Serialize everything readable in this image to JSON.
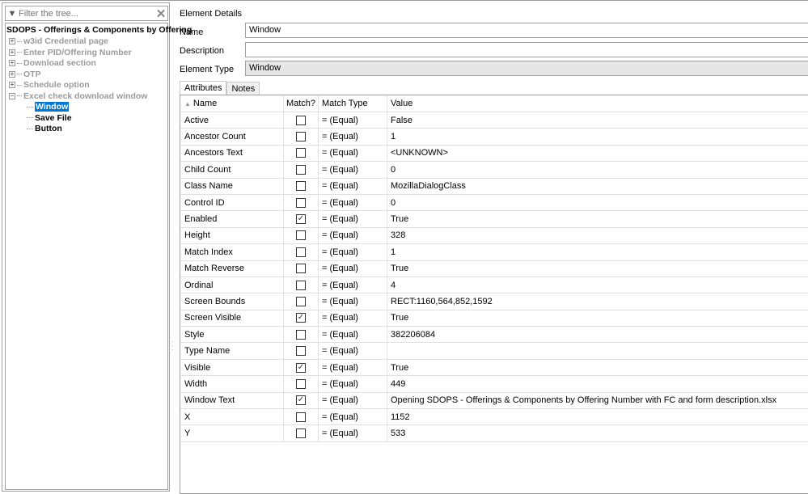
{
  "filter": {
    "placeholder": "Filter the tree..."
  },
  "tree": {
    "root": "SDOPS - Offerings & Components by Offering",
    "nodes": [
      "w3id Credential page",
      "Enter PID/Offering Number",
      "Download section",
      "OTP",
      "Schedule option",
      "Excel check download window"
    ],
    "children": [
      "Window",
      "Save File",
      "Button"
    ],
    "selected_child": "Window"
  },
  "details": {
    "title": "Element Details",
    "name_label": "Name",
    "name_value": "Window",
    "description_label": "Description",
    "description_value": "",
    "type_label": "Element Type",
    "type_value": "Window"
  },
  "tabs": [
    "Attributes",
    "Notes"
  ],
  "grid": {
    "headers": [
      "Name",
      "Match?",
      "Match Type",
      "Value"
    ],
    "rows": [
      {
        "name": "Active",
        "match": false,
        "type": "=  (Equal)",
        "value": "False"
      },
      {
        "name": "Ancestor Count",
        "match": false,
        "type": "=  (Equal)",
        "value": "1"
      },
      {
        "name": "Ancestors Text",
        "match": false,
        "type": "=  (Equal)",
        "value": "<UNKNOWN>"
      },
      {
        "name": "Child Count",
        "match": false,
        "type": "=  (Equal)",
        "value": "0"
      },
      {
        "name": "Class Name",
        "match": false,
        "type": "=  (Equal)",
        "value": "MozillaDialogClass"
      },
      {
        "name": "Control ID",
        "match": false,
        "type": "=  (Equal)",
        "value": "0"
      },
      {
        "name": "Enabled",
        "match": true,
        "type": "=  (Equal)",
        "value": "True"
      },
      {
        "name": "Height",
        "match": false,
        "type": "=  (Equal)",
        "value": "328"
      },
      {
        "name": "Match Index",
        "match": false,
        "type": "=  (Equal)",
        "value": "1"
      },
      {
        "name": "Match Reverse",
        "match": false,
        "type": "=  (Equal)",
        "value": "True"
      },
      {
        "name": "Ordinal",
        "match": false,
        "type": "=  (Equal)",
        "value": "4"
      },
      {
        "name": "Screen Bounds",
        "match": false,
        "type": "=  (Equal)",
        "value": "RECT:1160,564,852,1592"
      },
      {
        "name": "Screen Visible",
        "match": true,
        "type": "=  (Equal)",
        "value": "True"
      },
      {
        "name": "Style",
        "match": false,
        "type": "=  (Equal)",
        "value": "382206084"
      },
      {
        "name": "Type Name",
        "match": false,
        "type": "=  (Equal)",
        "value": ""
      },
      {
        "name": "Visible",
        "match": true,
        "type": "=  (Equal)",
        "value": "True"
      },
      {
        "name": "Width",
        "match": false,
        "type": "=  (Equal)",
        "value": "449"
      },
      {
        "name": "Window Text",
        "match": true,
        "type": "=  (Equal)",
        "value": "Opening SDOPS - Offerings & Components by Offering Number with FC and form description.xlsx"
      },
      {
        "name": "X",
        "match": false,
        "type": "=  (Equal)",
        "value": "1152"
      },
      {
        "name": "Y",
        "match": false,
        "type": "=  (Equal)",
        "value": "533"
      }
    ]
  }
}
